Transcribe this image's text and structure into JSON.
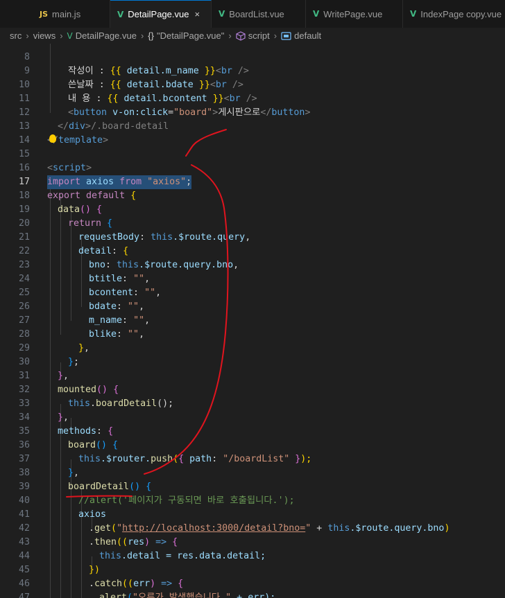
{
  "tabs": [
    {
      "label": "main.js",
      "icon": "JS"
    },
    {
      "label": "DetailPage.vue",
      "icon": "V",
      "close": "×"
    },
    {
      "label": "BoardList.vue",
      "icon": "V"
    },
    {
      "label": "WritePage.vue",
      "icon": "V"
    },
    {
      "label": "IndexPage copy.vue",
      "icon": "V"
    }
  ],
  "breadcrumb": {
    "items": [
      "src",
      "views",
      "DetailPage.vue",
      "\"DetailPage.vue\"",
      "script",
      "default"
    ],
    "braces_icon": "{}"
  },
  "colors": {
    "editor_bg": "#1f1f1f",
    "selection": "#264f78",
    "active_tab_border": "#0078d4",
    "vue_green": "#41b883",
    "annotation_red": "#e0141e"
  },
  "editor": {
    "current_line": "17",
    "line_numbers": [
      "8",
      "9",
      "10",
      "11",
      "12",
      "13",
      "14",
      "15",
      "16",
      "17",
      "18",
      "19",
      "20",
      "21",
      "22",
      "23",
      "24",
      "25",
      "26",
      "27",
      "28",
      "29",
      "30",
      "31",
      "32",
      "33",
      "34",
      "35",
      "36",
      "37",
      "38",
      "39",
      "40",
      "41",
      "42",
      "43",
      "44",
      "45",
      "46",
      "47"
    ],
    "code": {
      "l8a": "작성이 : ",
      "l8b": "{{",
      "l8c": " detail.m_name ",
      "l8d": "}}",
      "l8e": "<",
      "l8f": "br",
      "l8g": " />",
      "l9a": "쓴날짜 : ",
      "l9b": "{{",
      "l9c": " detail.bdate ",
      "l9d": "}}",
      "l9e": "<",
      "l9f": "br",
      "l9g": " />",
      "l10a": "내 용 : ",
      "l10b": "{{",
      "l10c": " detail.bcontent ",
      "l10d": "}}",
      "l10e": "<",
      "l10f": "br",
      "l10g": " />",
      "l11a": "<",
      "l11b": "button",
      "l11c": " v-on:click",
      "l11d": "=",
      "l11e": "\"board\"",
      "l11f": ">",
      "l11g": "게시판으로",
      "l11h": "</",
      "l11i": "button",
      "l11j": ">",
      "l12a": "</",
      "l12b": "div",
      "l12c": ">",
      "l12d": "/.board-detail",
      "l13a": "</",
      "l13b": "template",
      "l13c": ">",
      "l15a": "<",
      "l15b": "script",
      "l15c": ">",
      "l16a": "import",
      "l16b": " axios ",
      "l16c": "from",
      "l16d": " \"axios\"",
      "l16e": ";",
      "l17a": "export",
      "l17b": " default ",
      "l17c": "{",
      "l18a": "data",
      "l18b": "()",
      "l18c": " {",
      "l19a": "return",
      "l19b": " {",
      "l20a": "requestBody",
      "l20b": ": ",
      "l20c": "this",
      "l20d": ".$route.query",
      "l21a": "detail",
      "l21b": ": ",
      "l21c": "{",
      "l22a": "bno",
      "l22b": ": ",
      "l22c": "this",
      "l22d": ".$route.query.bno",
      "l23a": "btitle",
      "l23b": ": ",
      "l23c": "\"\"",
      "l24a": "bcontent",
      "l24b": ": ",
      "l24c": "\"\"",
      "l25a": "bdate",
      "l25b": ": ",
      "l25c": "\"\"",
      "l26a": "m_name",
      "l26b": ": ",
      "l26c": "\"\"",
      "l27a": "blike",
      "l27b": ": ",
      "l27c": "\"\"",
      "l28a": "}",
      "l29a": "}",
      "l30a": "}",
      "l31a": "mounted",
      "l31b": "()",
      "l31c": " {",
      "l32a": "this",
      "l32b": ".",
      "l32c": "boardDetail",
      "l32d": "();",
      "l33a": "}",
      "l34a": "methods",
      "l34b": ": ",
      "l34c": "{",
      "l35a": "board",
      "l35b": "()",
      "l35c": " {",
      "l36a": "this",
      "l36b": ".$router.",
      "l36c": "push",
      "l36d": "(",
      "l36e": "{",
      "l36f": " path",
      "l36g": ": ",
      "l36h": "\"/boardList\"",
      "l36i": " }",
      "l36j": ");",
      "l37a": "}",
      "l38a": "boardDetail",
      "l38b": "()",
      "l38c": " {",
      "l39a": "//alert('페이지가 구동되면 바로 호출됩니다.');",
      "l40a": "axios",
      "l41a": ".",
      "l41b": "get",
      "l41c": "(",
      "l41d": "\"",
      "l41e": "http://localhost:3000/detail?bno=",
      "l41f": "\"",
      "l41g": " + ",
      "l41h": "this",
      "l41i": ".$route.query.bno",
      "l41j": ")",
      "l42a": ".",
      "l42b": "then",
      "l42c": "((",
      "l42d": "res",
      "l42e": ")",
      "l42f": " => ",
      "l42g": "{",
      "l43a": "this",
      "l43b": ".detail = res.data.detail;",
      "l44a": "})",
      "l45a": ".",
      "l45b": "catch",
      "l45c": "((",
      "l45d": "err",
      "l45e": ")",
      "l45f": " => ",
      "l45g": "{",
      "l46a": "alert",
      "l46b": "(",
      "l46c": "\"오류가 발생했습니다.\"",
      "l46d": " + err);",
      "l47a": "});"
    }
  }
}
